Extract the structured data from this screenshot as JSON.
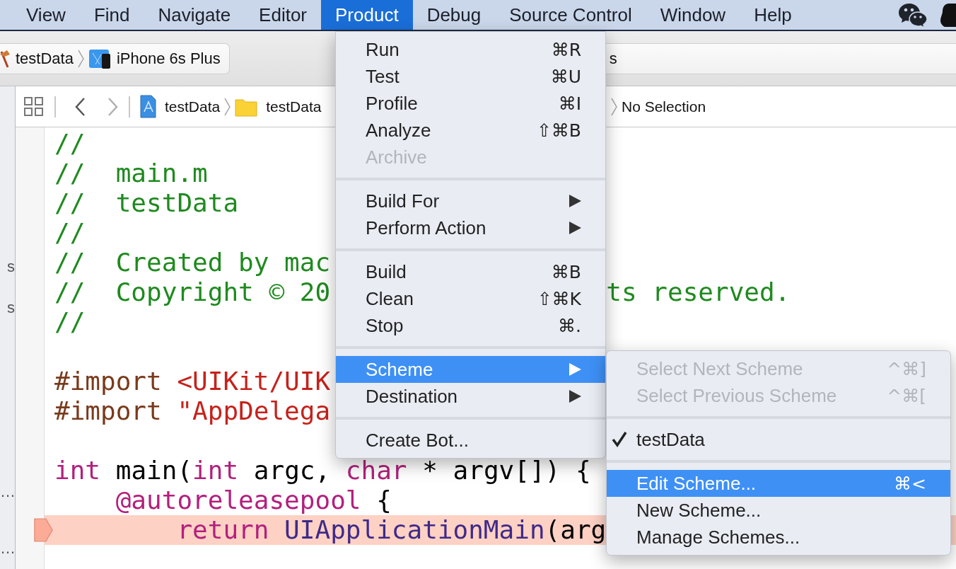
{
  "menu_bar": {
    "items": [
      {
        "label": "View",
        "selected": false
      },
      {
        "label": "Find",
        "selected": false
      },
      {
        "label": "Navigate",
        "selected": false
      },
      {
        "label": "Editor",
        "selected": false
      },
      {
        "label": "Product",
        "selected": true
      },
      {
        "label": "Debug",
        "selected": false
      },
      {
        "label": "Source Control",
        "selected": false
      },
      {
        "label": "Window",
        "selected": false
      },
      {
        "label": "Help",
        "selected": false
      }
    ]
  },
  "toolbar": {
    "scheme": "testData",
    "destination": "iPhone 6s Plus",
    "activity": "s"
  },
  "sidebar": {
    "items": [
      "s",
      "s",
      "…",
      "…"
    ]
  },
  "jump_bar": {
    "navigation": [
      {
        "kind": "back",
        "disabled": false
      },
      {
        "kind": "forward",
        "disabled": true
      }
    ],
    "path": [
      {
        "label": "testData",
        "kind": "project"
      },
      {
        "label": "testData",
        "kind": "folder"
      },
      {
        "label": "No Selection",
        "kind": "none"
      }
    ]
  },
  "editor": {
    "lines": [
      {
        "highlighted": false,
        "segments": [
          {
            "text": "//",
            "kind": "comment"
          }
        ]
      },
      {
        "highlighted": false,
        "segments": [
          {
            "text": "//  main.m",
            "kind": "comment"
          }
        ]
      },
      {
        "highlighted": false,
        "segments": [
          {
            "text": "//  testData",
            "kind": "comment"
          }
        ]
      },
      {
        "highlighted": false,
        "segments": [
          {
            "text": "//",
            "kind": "comment"
          }
        ]
      },
      {
        "highlighted": false,
        "segments": [
          {
            "text": "//  Created by mac",
            "kind": "comment"
          }
        ]
      },
      {
        "highlighted": false,
        "segments": [
          {
            "text": "//  Copyright © 20",
            "kind": "comment"
          },
          {
            "text": "ts reserved.",
            "kind": "comment",
            "gap_before": true
          }
        ]
      },
      {
        "highlighted": false,
        "segments": [
          {
            "text": "//",
            "kind": "comment"
          }
        ]
      },
      {
        "highlighted": false
      },
      {
        "highlighted": false,
        "segments": [
          {
            "text": "#import ",
            "kind": "preproc"
          },
          {
            "text": "<UIKit/UIK",
            "kind": "string"
          }
        ]
      },
      {
        "highlighted": false,
        "segments": [
          {
            "text": "#import ",
            "kind": "preproc"
          },
          {
            "text": "\"AppDelega",
            "kind": "string"
          }
        ]
      },
      {
        "highlighted": false
      },
      {
        "highlighted": false,
        "segments": [
          {
            "text": "int",
            "kind": "keyword"
          },
          {
            "text": " main(",
            "kind": "plain"
          },
          {
            "text": "int",
            "kind": "keyword"
          },
          {
            "text": " argc, ",
            "kind": "plain"
          },
          {
            "text": "char",
            "kind": "keyword"
          },
          {
            "text": " * argv[]) {",
            "kind": "plain"
          }
        ]
      },
      {
        "highlighted": false,
        "segments": [
          {
            "text": "    @autoreleasepool",
            "kind": "keyword"
          },
          {
            "text": " {",
            "kind": "plain"
          }
        ]
      },
      {
        "highlighted": true,
        "segments": [
          {
            "text": "        return",
            "kind": "keyword"
          },
          {
            "text": " UIApplicationMain",
            "kind": "function"
          },
          {
            "text": "(arg",
            "kind": "plain"
          }
        ]
      }
    ]
  },
  "product_menu": {
    "items": [
      {
        "kind": "item",
        "label": "Run",
        "shortcut": "⌘R",
        "disabled": false,
        "selected": false
      },
      {
        "kind": "item",
        "label": "Test",
        "shortcut": "⌘U",
        "disabled": false,
        "selected": false
      },
      {
        "kind": "item",
        "label": "Profile",
        "shortcut": "⌘I",
        "disabled": false,
        "selected": false
      },
      {
        "kind": "item",
        "label": "Analyze",
        "shortcut": "⇧⌘B",
        "disabled": false,
        "selected": false
      },
      {
        "kind": "item",
        "label": "Archive",
        "disabled": true,
        "selected": false
      },
      {
        "kind": "separator"
      },
      {
        "kind": "submenu",
        "label": "Build For",
        "disabled": false,
        "selected": false
      },
      {
        "kind": "submenu",
        "label": "Perform Action",
        "disabled": false,
        "selected": false
      },
      {
        "kind": "separator"
      },
      {
        "kind": "item",
        "label": "Build",
        "shortcut": "⌘B",
        "disabled": false,
        "selected": false
      },
      {
        "kind": "item",
        "label": "Clean",
        "shortcut": "⇧⌘K",
        "disabled": false,
        "selected": false
      },
      {
        "kind": "item",
        "label": "Stop",
        "shortcut": "⌘.",
        "disabled": false,
        "selected": false
      },
      {
        "kind": "separator"
      },
      {
        "kind": "submenu",
        "label": "Scheme",
        "disabled": false,
        "selected": true
      },
      {
        "kind": "submenu",
        "label": "Destination",
        "disabled": false,
        "selected": false
      },
      {
        "kind": "separator"
      },
      {
        "kind": "item",
        "label": "Create Bot...",
        "disabled": false,
        "selected": false
      }
    ]
  },
  "scheme_submenu": {
    "items": [
      {
        "kind": "item",
        "label": "Select Next Scheme",
        "shortcut": "^⌘]",
        "disabled": true,
        "selected": false,
        "checked": false
      },
      {
        "kind": "item",
        "label": "Select Previous Scheme",
        "shortcut": "^⌘[",
        "disabled": true,
        "selected": false,
        "checked": false
      },
      {
        "kind": "separator"
      },
      {
        "kind": "item",
        "label": "testData",
        "disabled": false,
        "selected": false,
        "checked": true
      },
      {
        "kind": "separator"
      },
      {
        "kind": "item",
        "label": "Edit Scheme...",
        "shortcut": "⌘<",
        "disabled": false,
        "selected": true,
        "checked": false
      },
      {
        "kind": "item",
        "label": "New Scheme...",
        "disabled": false,
        "selected": false,
        "checked": false
      },
      {
        "kind": "item",
        "label": "Manage Schemes...",
        "disabled": false,
        "selected": false,
        "checked": false
      }
    ]
  }
}
